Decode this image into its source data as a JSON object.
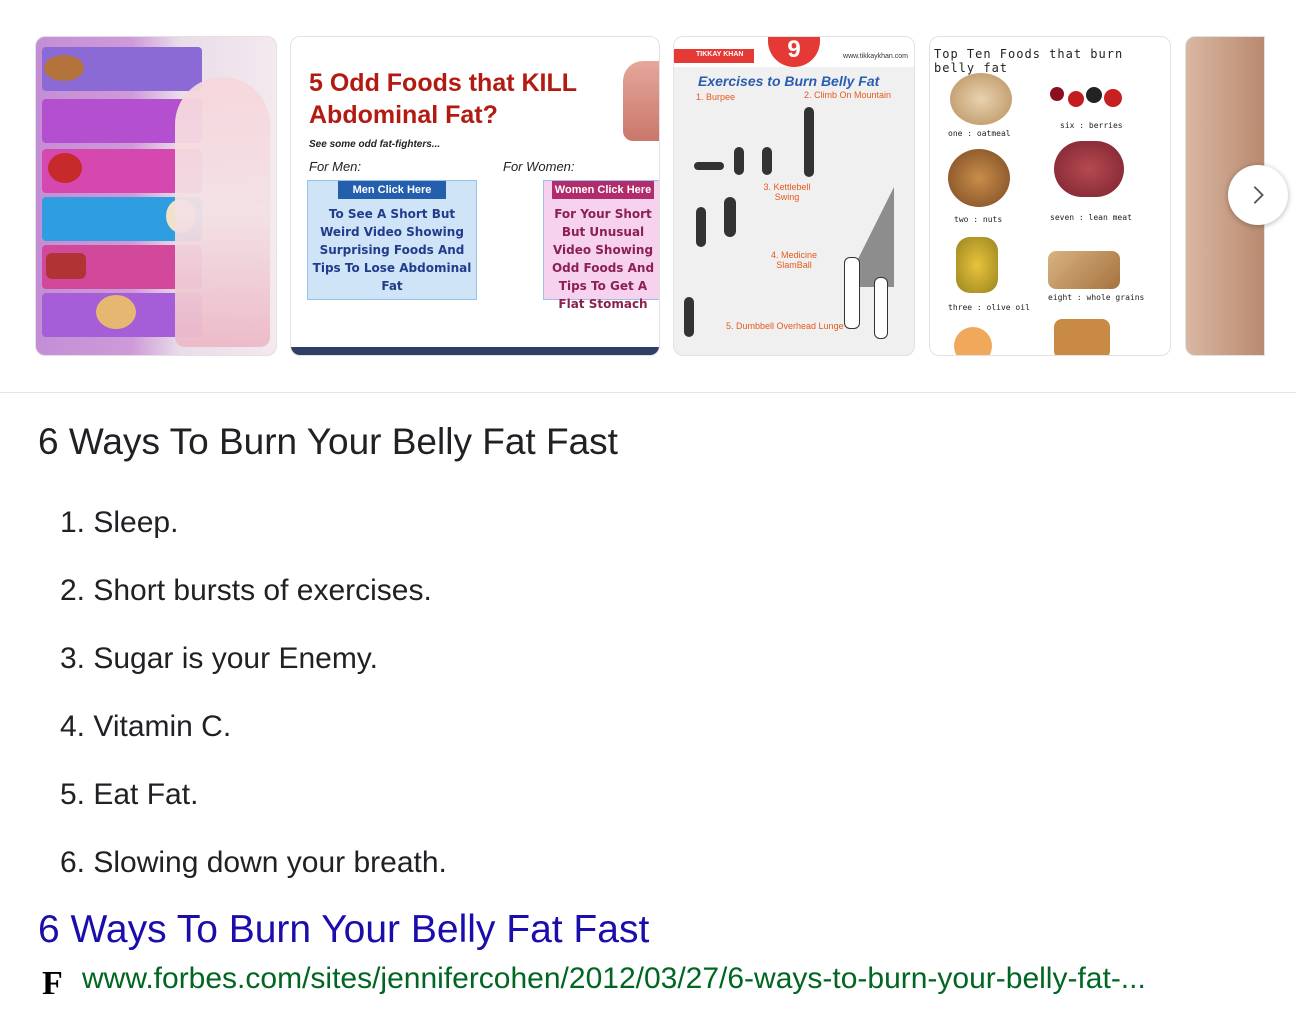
{
  "carousel": {
    "images": [
      {
        "alt": "infographic of fat-burning foods"
      },
      {
        "title": "5 Odd Foods that KILL Abdominal Fat?",
        "subtitle": "See some odd fat-fighters...",
        "for_men": "For Men:",
        "for_women": "For Women:",
        "men_button": "Men Click Here",
        "men_text": "To See A Short But Weird Video Showing Surprising Foods And Tips To Lose Abdominal Fat",
        "women_button": "Women Click Here",
        "women_text": "For Your Short But Unusual Video Showing Odd Foods And Tips To Get A Flat Stomach"
      },
      {
        "number": "9",
        "brand": "TIKKAY KHAN",
        "site": "www.tikkaykhan.com",
        "title": "Exercises to Burn Belly Fat",
        "labels": [
          "1. Burpee",
          "2. Climb On Mountain",
          "3. Kettlebell Swing",
          "4. Medicine SlamBall",
          "5. Dumbbell Overhead Lunge"
        ]
      },
      {
        "title": "Top Ten Foods that burn belly fat",
        "items": [
          "one : oatmeal",
          "six : berries",
          "two : nuts",
          "seven : lean meat",
          "three : olive oil",
          "eight : whole grains"
        ]
      },
      {
        "alt": "belly photo"
      }
    ],
    "next_icon": "chevron-right-icon"
  },
  "answer": {
    "heading": "6 Ways To Burn Your Belly Fat Fast",
    "items": [
      "1. Sleep.",
      "2. Short bursts of exercises.",
      "3. Sugar is your Enemy.",
      "4. Vitamin C.",
      "5. Eat Fat.",
      "6. Slowing down your breath."
    ]
  },
  "source": {
    "title": "6 Ways To Burn Your Belly Fat Fast",
    "favicon_letter": "F",
    "url": "www.forbes.com/sites/jennifercohen/2012/03/27/6-ways-to-burn-your-belly-fat-..."
  },
  "colors": {
    "link": "#1a0dab",
    "url": "#006621"
  }
}
